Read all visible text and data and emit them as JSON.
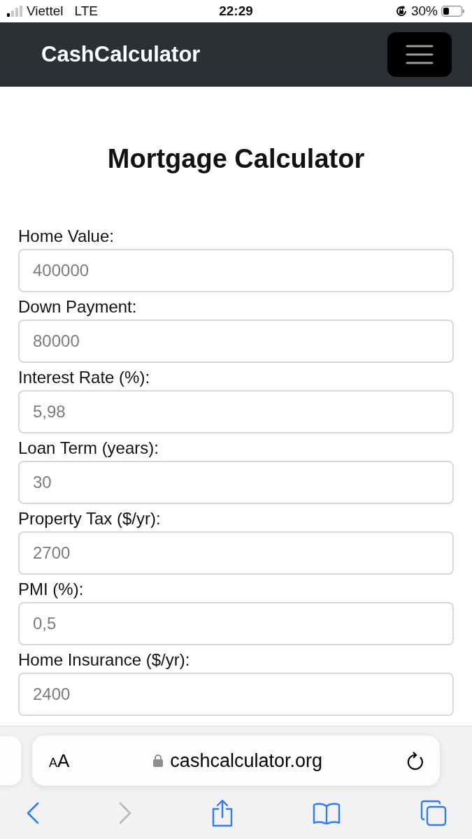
{
  "status_bar": {
    "carrier": "Viettel",
    "network": "LTE",
    "time": "22:29",
    "battery": "30%"
  },
  "navbar": {
    "brand": "CashCalculator"
  },
  "title": "Mortgage Calculator",
  "fields": [
    {
      "label": "Home Value:",
      "placeholder": "400000"
    },
    {
      "label": "Down Payment:",
      "placeholder": "80000"
    },
    {
      "label": "Interest Rate (%):",
      "placeholder": "5,98"
    },
    {
      "label": "Loan Term (years):",
      "placeholder": "30"
    },
    {
      "label": "Property Tax ($/yr):",
      "placeholder": "2700"
    },
    {
      "label": "PMI (%):",
      "placeholder": "0,5"
    },
    {
      "label": "Home Insurance ($/yr):",
      "placeholder": "2400"
    }
  ],
  "browser": {
    "text_size": "AA",
    "url": "cashcalculator.org",
    "forward_disabled": true
  }
}
